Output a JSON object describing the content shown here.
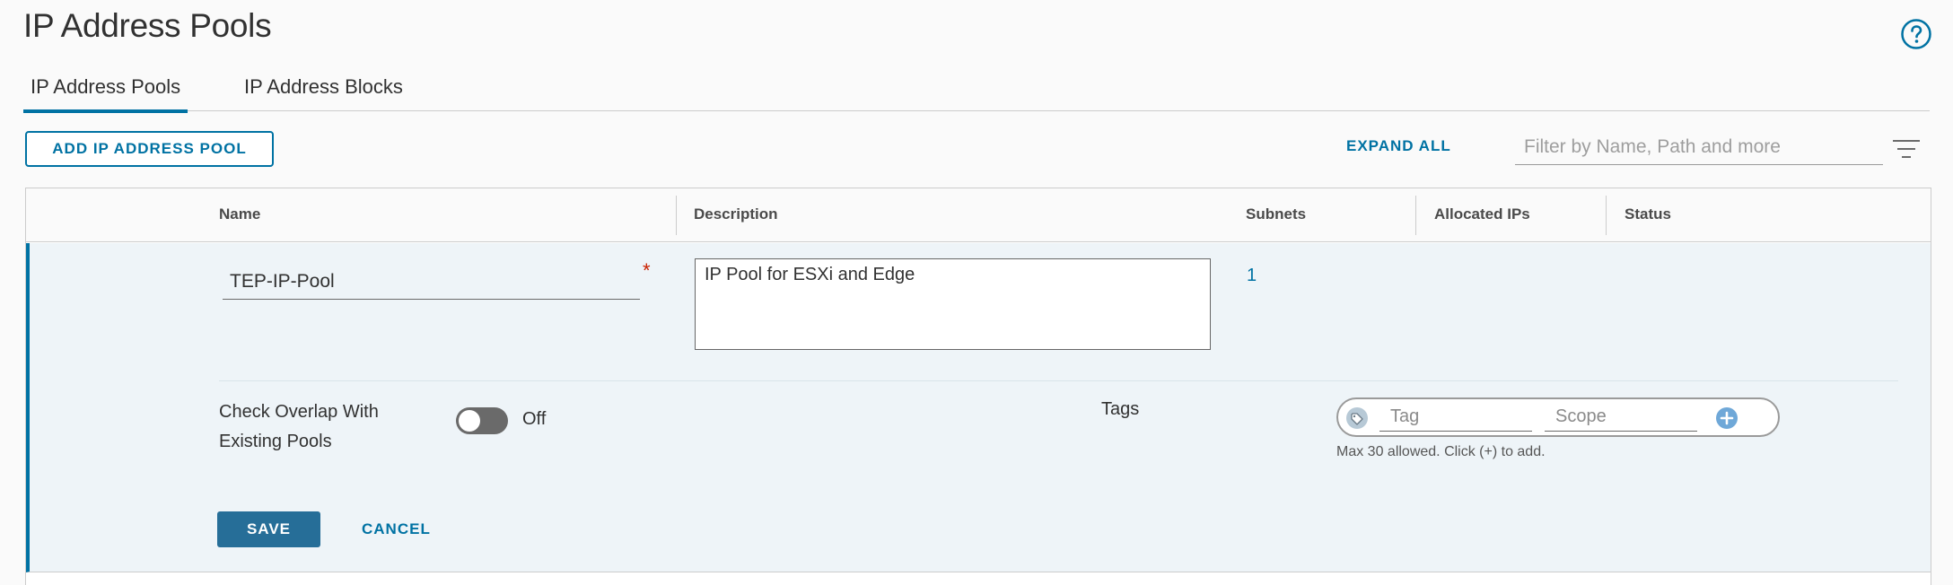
{
  "page": {
    "title": "IP Address Pools"
  },
  "tabs": [
    {
      "label": "IP Address Pools"
    },
    {
      "label": "IP Address Blocks"
    }
  ],
  "toolbar": {
    "add_label": "ADD IP ADDRESS POOL",
    "expand_all_label": "EXPAND ALL",
    "filter_placeholder": "Filter by Name, Path and more"
  },
  "grid": {
    "columns": {
      "name": "Name",
      "description": "Description",
      "subnets": "Subnets",
      "allocated_ips": "Allocated IPs",
      "status": "Status"
    },
    "edit_row": {
      "name_value": "TEP-IP-Pool",
      "required_mark": "*",
      "description_value": "IP Pool for ESXi and Edge",
      "subnets_value": "1",
      "overlap_label": "Check Overlap With Existing Pools",
      "toggle_state": "Off",
      "tags_label": "Tags",
      "tag_placeholder": "Tag",
      "scope_placeholder": "Scope",
      "tags_hint": "Max 30 allowed. Click (+) to add.",
      "save_label": "SAVE",
      "cancel_label": "CANCEL"
    }
  },
  "colors": {
    "accent": "#0072a3",
    "save_button": "#266e98",
    "required": "#c92100",
    "row_background": "#eef4f8"
  }
}
